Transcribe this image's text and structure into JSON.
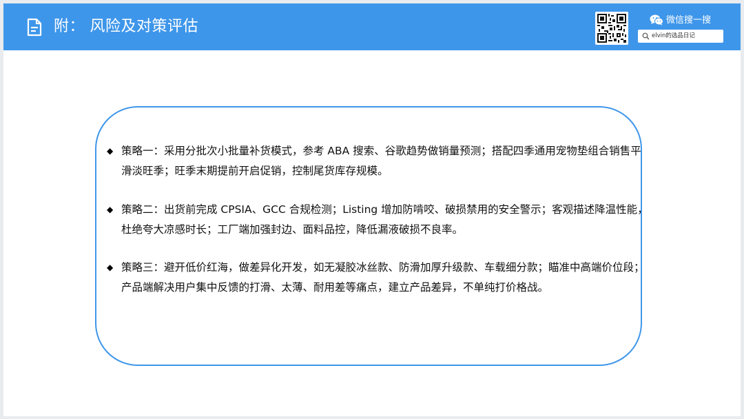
{
  "header": {
    "title": "附：  风险及对策评估",
    "icon": "document-icon",
    "background_color": "#3e96ea"
  },
  "wechat": {
    "label": "微信搜一搜",
    "icon": "wechat-icon",
    "search_text": "elvin的选品日记",
    "search_icon": "search-icon"
  },
  "qr_code": {
    "icon": "qr-code"
  },
  "card": {
    "border_color": "#3e96ea",
    "strategies": [
      {
        "bullet": "◆",
        "text": "策略一：采用分批次小批量补货模式，参考 ABA 搜索、谷歌趋势做销量预测；搭配四季通用宠物垫组合销售平滑淡旺季；旺季末期提前开启促销，控制尾货库存规模。"
      },
      {
        "bullet": "◆",
        "text": "策略二：出货前完成 CPSIA、GCC 合规检测；Listing 增加防啃咬、破损禁用的安全警示；客观描述降温性能，杜绝夸大凉感时长；工厂端加强封边、面料品控，降低漏液破损不良率。"
      },
      {
        "bullet": "◆",
        "text": "策略三：避开低价红海，做差异化开发，如无凝胶冰丝款、防滑加厚升级款、车载细分款；瞄准中高端价位段；产品端解决用户集中反馈的打滑、太薄、耐用差等痛点，建立产品差异，不单纯打价格战。"
      }
    ]
  }
}
